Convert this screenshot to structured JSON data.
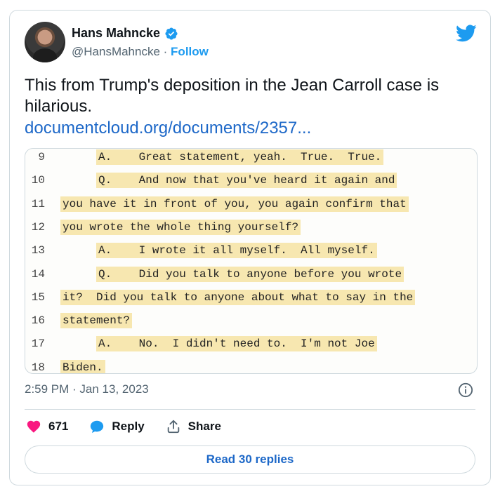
{
  "author": {
    "name": "Hans Mahncke",
    "handle": "@HansMahncke",
    "separator": " · ",
    "follow_label": "Follow"
  },
  "tweet": {
    "text": "This from Trump's deposition in the Jean Carroll case is hilarious.",
    "link": "documentcloud.org/documents/2357..."
  },
  "document": {
    "lines": [
      {
        "num": "9",
        "text": "A.    Great statement, yeah.  True.  True.",
        "indent": "answer"
      },
      {
        "num": "10",
        "text": "Q.    And now that you've heard it again and",
        "indent": "answer"
      },
      {
        "num": "11",
        "text": "you have it in front of you, you again confirm that",
        "indent": "none"
      },
      {
        "num": "12",
        "text": "you wrote the whole thing yourself?",
        "indent": "none"
      },
      {
        "num": "13",
        "text": "A.    I wrote it all myself.  All myself.",
        "indent": "answer"
      },
      {
        "num": "14",
        "text": "Q.    Did you talk to anyone before you wrote",
        "indent": "answer"
      },
      {
        "num": "15",
        "text": "it?  Did you talk to anyone about what to say in the",
        "indent": "none"
      },
      {
        "num": "16",
        "text": "statement?",
        "indent": "none"
      },
      {
        "num": "17",
        "text": "A.    No.  I didn't need to.  I'm not Joe",
        "indent": "answer"
      },
      {
        "num": "18",
        "text": "Biden.",
        "indent": "none"
      }
    ]
  },
  "meta": {
    "timestamp": "2:59 PM · Jan 13, 2023"
  },
  "actions": {
    "like_count": "671",
    "reply_label": "Reply",
    "share_label": "Share"
  },
  "read_replies_label": "Read 30 replies",
  "colors": {
    "accent": "#1d9bf0",
    "link": "#1d68c8",
    "like": "#f91880",
    "highlight": "#f7e7b0"
  },
  "icons": [
    "verified-badge-icon",
    "twitter-bird-icon",
    "info-icon",
    "heart-icon",
    "reply-bubble-icon",
    "share-icon"
  ]
}
